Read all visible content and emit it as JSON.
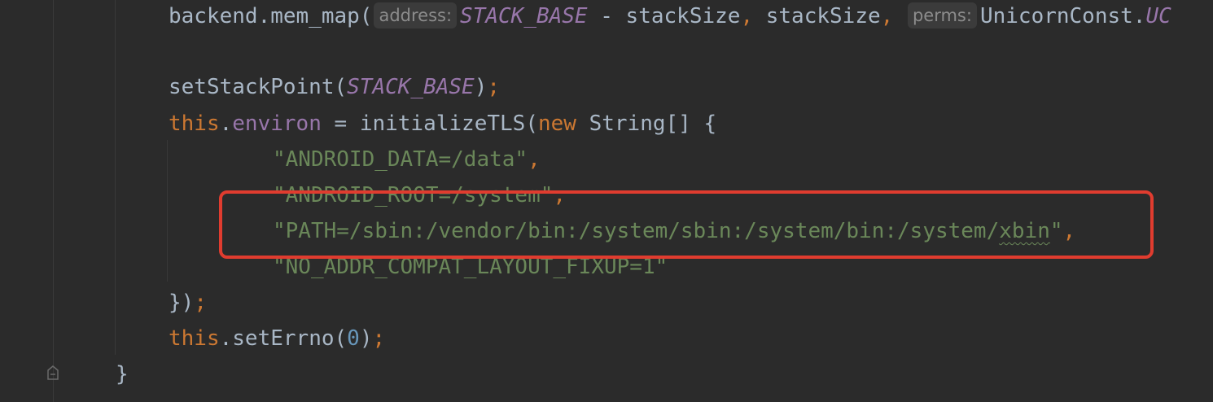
{
  "colors": {
    "background": "#2b2b2b",
    "keyword": "#cc7832",
    "string": "#6a8759",
    "field": "#9876aa",
    "number": "#6897bb",
    "highlight_box": "#e03c2f"
  },
  "code": {
    "line1": {
      "obj": "backend",
      "dot": ".",
      "method": "mem_map(",
      "hint_address": "address:",
      "const": "STACK_BASE",
      "rest": " - stackSize",
      "comma1": ",",
      "arg2": " stackSize",
      "comma2": ",",
      "hint_perms": "perms:",
      "tail": "UnicornConst.",
      "tail_const": "UC"
    },
    "line2": {
      "call": "setStackPoint(",
      "const": "STACK_BASE",
      "close": ")",
      "semi": ";"
    },
    "line3": {
      "this": "this",
      "dot": ".",
      "field": "environ",
      "eq": " = initializeTLS(",
      "new": "new",
      "type": " String[] {"
    },
    "line4": {
      "str": "\"ANDROID_DATA=/data\"",
      "comma": ","
    },
    "line5": {
      "str": "\"ANDROID_ROOT=/system\"",
      "comma": ","
    },
    "line6": {
      "str_a": "\"PATH=/sbin:/vendor/bin:/system/sbin:/system/bin:/system/",
      "str_squiggle": "xbin",
      "str_b": "\"",
      "comma": ","
    },
    "line7": {
      "str": "\"NO_ADDR_COMPAT_LAYOUT_FIXUP=1\""
    },
    "line8": {
      "close": "})",
      "semi": ";"
    },
    "line9": {
      "this": "this",
      "dot": ".",
      "call": "setErrno(",
      "num": "0",
      "close": ")",
      "semi": ";"
    },
    "line10": {
      "brace": "}"
    }
  }
}
